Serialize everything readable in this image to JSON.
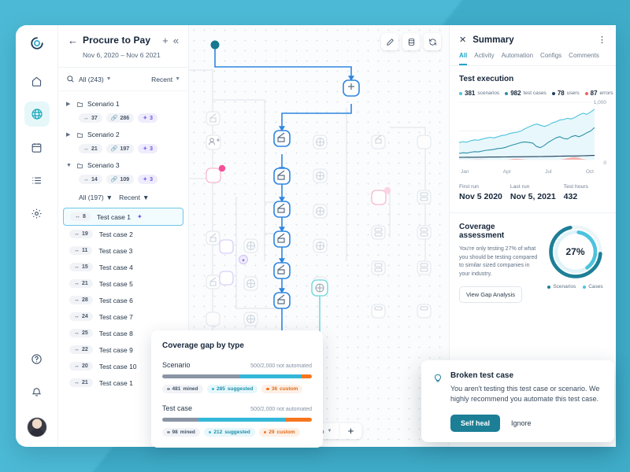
{
  "rail": {
    "logo": "logo-icon",
    "items": [
      {
        "name": "home",
        "icon": "home-icon",
        "active": false
      },
      {
        "name": "explore",
        "icon": "globe-icon",
        "active": true
      },
      {
        "name": "calendar",
        "icon": "calendar-icon",
        "active": false
      },
      {
        "name": "list",
        "icon": "list-icon",
        "active": false
      },
      {
        "name": "settings",
        "icon": "gear-icon",
        "active": false
      }
    ],
    "bottom": [
      {
        "name": "help",
        "icon": "help-circle-icon"
      },
      {
        "name": "notifications",
        "icon": "bell-icon"
      },
      {
        "name": "account",
        "icon": "avatar"
      }
    ]
  },
  "panel": {
    "title": "Procure to Pay",
    "date_range": "Nov 6, 2020 – Nov 6 2021",
    "back_icon": "arrow-left-icon",
    "add_icon": "plus-icon",
    "collapse_icon": "chevrons-left-icon",
    "search_icon": "search-icon",
    "filter_all": "All (243)",
    "filter_sort": "Recent",
    "scenarios": [
      {
        "label": "Scenario 1",
        "expanded": false,
        "chips": [
          {
            "icon": "steps-icon",
            "value": "37"
          },
          {
            "icon": "link-icon",
            "value": "286"
          },
          {
            "icon": "spark-icon",
            "value": "3",
            "accent": true
          }
        ]
      },
      {
        "label": "Scenario 2",
        "expanded": false,
        "chips": [
          {
            "icon": "steps-icon",
            "value": "21"
          },
          {
            "icon": "link-icon",
            "value": "197"
          },
          {
            "icon": "spark-icon",
            "value": "3",
            "accent": true
          }
        ]
      },
      {
        "label": "Scenario 3",
        "expanded": true,
        "chips": [
          {
            "icon": "steps-icon",
            "value": "14"
          },
          {
            "icon": "link-icon",
            "value": "109"
          },
          {
            "icon": "spark-icon",
            "value": "3",
            "accent": true
          }
        ]
      }
    ],
    "subfilter_all": "All (197)",
    "subfilter_sort": "Recent",
    "test_cases": [
      {
        "count": "8",
        "label": "Test case 1",
        "selected": true,
        "spark": true
      },
      {
        "count": "19",
        "label": "Test case 2",
        "selected": false,
        "spark": false
      },
      {
        "count": "11",
        "label": "Test case 3",
        "selected": false,
        "spark": false
      },
      {
        "count": "15",
        "label": "Test case 4",
        "selected": false,
        "spark": false
      },
      {
        "count": "21",
        "label": "Test case 5",
        "selected": false,
        "spark": false
      },
      {
        "count": "28",
        "label": "Test case 6",
        "selected": false,
        "spark": false
      },
      {
        "count": "24",
        "label": "Test case 7",
        "selected": false,
        "spark": false
      },
      {
        "count": "25",
        "label": "Test case 8",
        "selected": false,
        "spark": false
      },
      {
        "count": "22",
        "label": "Test case 9",
        "selected": false,
        "spark": false
      },
      {
        "count": "20",
        "label": "Test case 10",
        "selected": false,
        "spark": false
      },
      {
        "count": "21",
        "label": "Test case 1",
        "selected": false,
        "spark": false
      }
    ]
  },
  "canvas": {
    "tools": [
      {
        "name": "edit",
        "icon": "pencil-icon"
      },
      {
        "name": "data",
        "icon": "database-icon"
      },
      {
        "name": "refresh",
        "icon": "refresh-icon"
      }
    ],
    "zoom_out_icon": "minus-icon",
    "zoom_level": "100%",
    "zoom_caret": "chevron-down-icon",
    "zoom_in_icon": "plus-icon",
    "accent": "#2f86e0",
    "accent_teal": "#6fd5dd"
  },
  "summary": {
    "close_icon": "close-icon",
    "title": "Summary",
    "more_icon": "more-vertical-icon",
    "tabs": [
      {
        "label": "All",
        "active": true
      },
      {
        "label": "Activity",
        "active": false
      },
      {
        "label": "Automation",
        "active": false
      },
      {
        "label": "Configs",
        "active": false
      },
      {
        "label": "Comments",
        "active": false
      }
    ],
    "test_execution": {
      "heading": "Test execution",
      "legend": [
        {
          "value": "381",
          "label": "scenarios",
          "color": "#4cc3de"
        },
        {
          "value": "982",
          "label": "test cases",
          "color": "#2a8fa8"
        },
        {
          "value": "78",
          "label": "users",
          "color": "#1d3f5c"
        },
        {
          "value": "87",
          "label": "errors",
          "color": "#f0615a"
        }
      ]
    },
    "stats": [
      {
        "label": "First run",
        "value": "Nov 5 2020"
      },
      {
        "label": "Last run",
        "value": "Nov 5, 2021"
      },
      {
        "label": "Test hours",
        "value": "432"
      }
    ],
    "coverage": {
      "heading": "Coverage assessment",
      "text": "You're only testing 27% of what you should be testing compared to similar sized companies in your industry.",
      "button": "View Gap Analysis",
      "donut_label": "27%",
      "legend": [
        {
          "label": "Scenarios",
          "color": "#1c7f96"
        },
        {
          "label": "Cases",
          "color": "#4cc3de"
        }
      ]
    }
  },
  "gap_card": {
    "title": "Coverage gap by type",
    "rows": [
      {
        "name": "Scenario",
        "meta": "500/2,000 not automated",
        "segments": [
          {
            "color": "#8a95a5",
            "pct": 52
          },
          {
            "color": "#33b7d8",
            "pct": 41
          },
          {
            "color": "#f5761f",
            "pct": 7
          }
        ],
        "chips": [
          {
            "value": "481",
            "label": "mined",
            "dot": "#8a95a5",
            "bg": "#f1f3f7",
            "fg": "#44556a"
          },
          {
            "value": "285",
            "label": "suggested",
            "dot": "#33b7d8",
            "bg": "#e7f7fb",
            "fg": "#1d8fab"
          },
          {
            "value": "36",
            "label": "custom",
            "dot": "#f5761f",
            "bg": "#fdf0e6",
            "fg": "#e06a18"
          }
        ]
      },
      {
        "name": "Test case",
        "meta": "500/2,000 not automated",
        "segments": [
          {
            "color": "#8a95a5",
            "pct": 24
          },
          {
            "color": "#33b7d8",
            "pct": 58
          },
          {
            "color": "#f5761f",
            "pct": 18
          }
        ],
        "chips": [
          {
            "value": "98",
            "label": "mined",
            "dot": "#8a95a5",
            "bg": "#f1f3f7",
            "fg": "#44556a"
          },
          {
            "value": "212",
            "label": "suggested",
            "dot": "#33b7d8",
            "bg": "#e7f7fb",
            "fg": "#1d8fab"
          },
          {
            "value": "29",
            "label": "custom",
            "dot": "#f5761f",
            "bg": "#fdf0e6",
            "fg": "#e06a18"
          }
        ]
      }
    ]
  },
  "toast": {
    "icon": "lightbulb-icon",
    "title": "Broken test case",
    "body": "You aren't testing this test case or scenario. We highly recommend you automate this test case.",
    "primary": "Self heal",
    "secondary": "Ignore"
  },
  "chart_data": {
    "type": "line",
    "title": "Test execution",
    "xlabel": "",
    "ylabel": "",
    "ylim": [
      0,
      1000
    ],
    "y_ticks": [
      "1,000",
      "0"
    ],
    "categories": [
      "Jan",
      "Apr",
      "Jul",
      "Oct"
    ],
    "x_tick_labels": [
      "Jan",
      "Apr",
      "Jul",
      "Oct"
    ],
    "grid": true,
    "legend_position": "top",
    "series": [
      {
        "name": "scenarios",
        "color": "#4cc3de",
        "total": 381,
        "values": [
          300,
          312,
          305,
          330,
          345,
          340,
          360,
          375,
          390,
          380,
          400,
          420,
          430,
          455,
          470,
          480,
          500,
          540,
          570,
          600,
          620,
          600,
          580,
          600,
          640,
          660,
          690,
          700,
          720,
          710,
          740,
          780,
          810,
          790,
          830,
          880
        ]
      },
      {
        "name": "test cases",
        "color": "#2a8fa8",
        "total": 982,
        "values": [
          110,
          120,
          115,
          130,
          140,
          135,
          150,
          165,
          170,
          180,
          195,
          200,
          215,
          240,
          260,
          280,
          300,
          310,
          300,
          290,
          230,
          210,
          250,
          300,
          340,
          380,
          400,
          370,
          360,
          400,
          420,
          400,
          430,
          470,
          500,
          560
        ]
      },
      {
        "name": "users",
        "color": "#1d3f5c",
        "total": 78,
        "values": [
          40,
          41,
          42,
          42,
          43,
          44,
          44,
          45,
          46,
          46,
          47,
          48,
          48,
          49,
          50,
          50,
          51,
          52,
          52,
          53,
          54,
          55,
          56,
          57,
          58,
          60,
          62,
          63,
          64,
          64,
          65,
          66,
          68,
          70,
          72,
          74
        ]
      },
      {
        "name": "errors",
        "color": "#f0615a",
        "total": 87,
        "values": [
          0,
          0,
          0,
          0,
          2,
          6,
          2,
          0,
          0,
          0,
          0,
          0,
          0,
          4,
          14,
          18,
          10,
          3,
          0,
          0,
          0,
          0,
          0,
          0,
          0,
          0,
          0,
          8,
          26,
          40,
          44,
          30,
          10,
          0,
          0,
          0
        ]
      }
    ]
  },
  "donut_data": {
    "type": "pie",
    "label": "27%",
    "slices": [
      {
        "name": "Scenarios",
        "value": 62,
        "color": "#1c7f96"
      },
      {
        "name": "Cases",
        "value": 38,
        "color": "#4cc3de"
      }
    ]
  }
}
